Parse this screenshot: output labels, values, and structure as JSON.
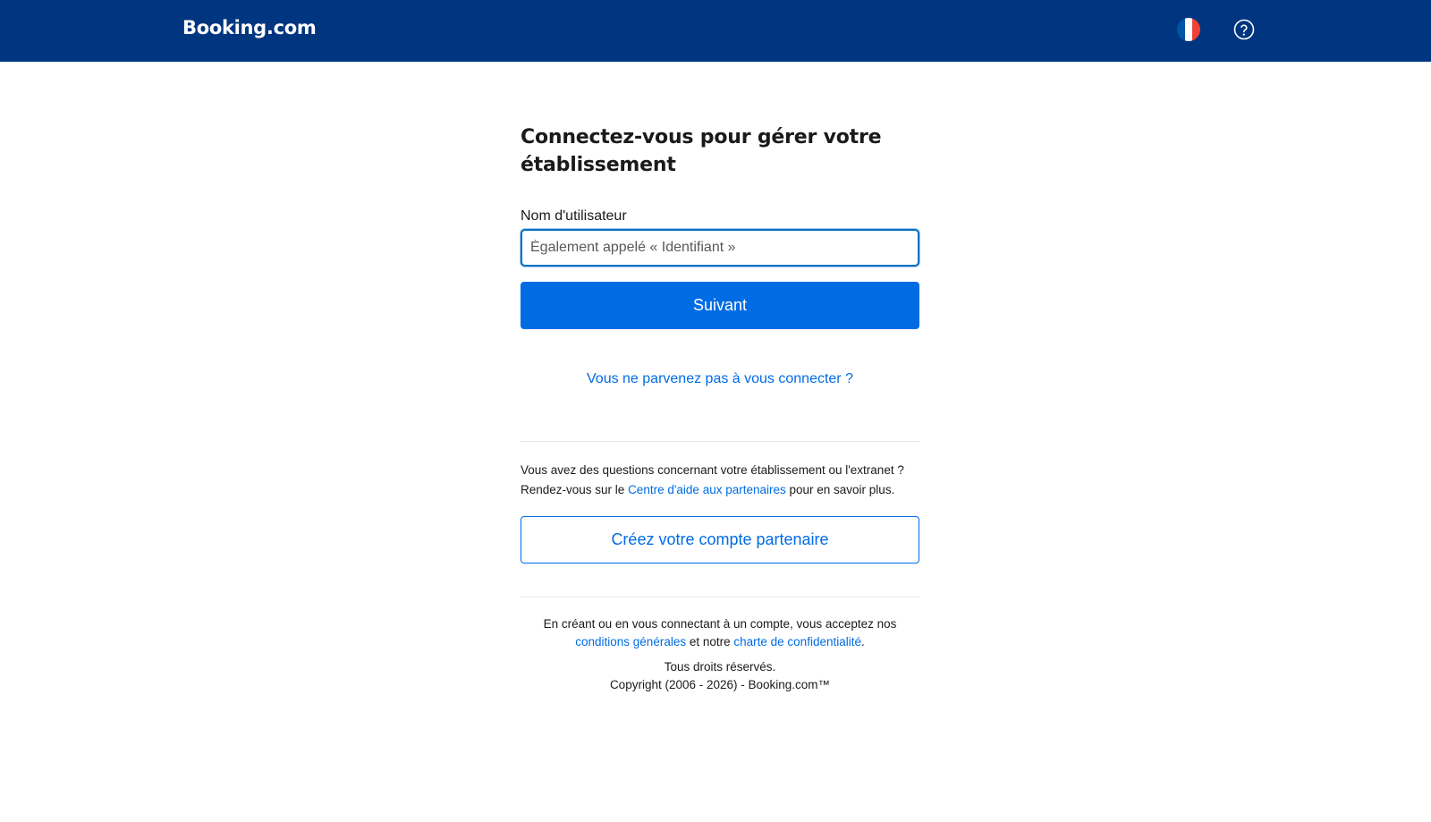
{
  "header": {
    "logo_text": "Booking.com",
    "language_flag": "flag-fr-icon",
    "help_icon": "help-circle-icon",
    "background_color": "#003580"
  },
  "login": {
    "title": "Connectez-vous pour gérer votre établissement",
    "username_label": "Nom d'utilisateur",
    "username_value": "",
    "username_placeholder": "Également appelé « Identifiant »",
    "next_button": "Suivant",
    "forgot_link": "Vous ne parvenez pas à vous connecter ?"
  },
  "help_section": {
    "text_before": "Vous avez des questions concernant votre établissement ou l'extranet ? Rendez-vous sur le ",
    "link_text": "Centre d'aide aux partenaires",
    "text_after": " pour en savoir plus.",
    "create_account_button": "Créez votre compte partenaire"
  },
  "footer": {
    "legal_before": "En créant ou en vous connectant à un compte, vous acceptez nos",
    "terms_link": "conditions générales",
    "legal_middle": " et notre ",
    "privacy_link": "charte de confidentialité",
    "legal_end": ".",
    "rights": "Tous droits réservés.",
    "copyright": "Copyright (2006 - 2026) - Booking.com™"
  },
  "colors": {
    "primary": "#006ce4",
    "brand_dark": "#003580"
  }
}
